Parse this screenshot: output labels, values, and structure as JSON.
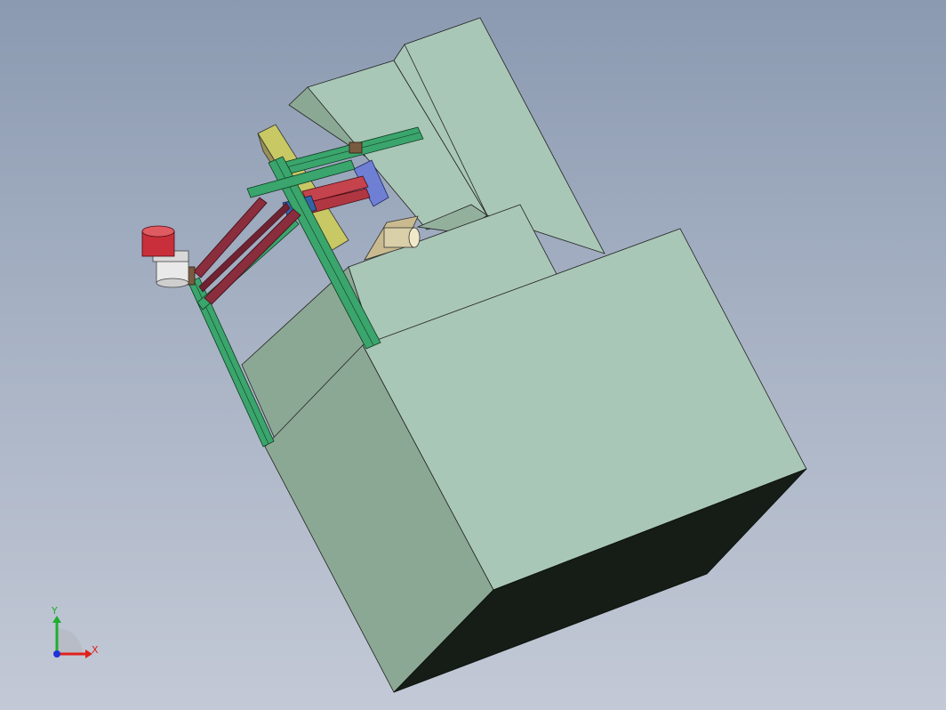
{
  "viewport": {
    "background_top": "#8b9ab1",
    "background_bottom": "#c3c9d6"
  },
  "model": {
    "body_color_light": "#a9c7b6",
    "body_color_mid": "#9cb9a6",
    "body_color_shade": "#8ba894",
    "body_color_dark": "#151d16",
    "frame_color": "#3aa56c",
    "frame_edge": "#123a22",
    "beam_color": "#8a2d3c",
    "cylinder_color": "#d9cfa8",
    "support_color": "#c8c864",
    "actuator_color": "#6f7fd3",
    "slide_color": "#c4434d",
    "lamp_color": "#c92f3a",
    "lamp_base_color": "#e9e9e9"
  },
  "triad": {
    "x_label": "X",
    "y_label": "Y",
    "x_color": "#e0201a",
    "y_color": "#1fae2f",
    "z_color": "#1f34d6"
  }
}
